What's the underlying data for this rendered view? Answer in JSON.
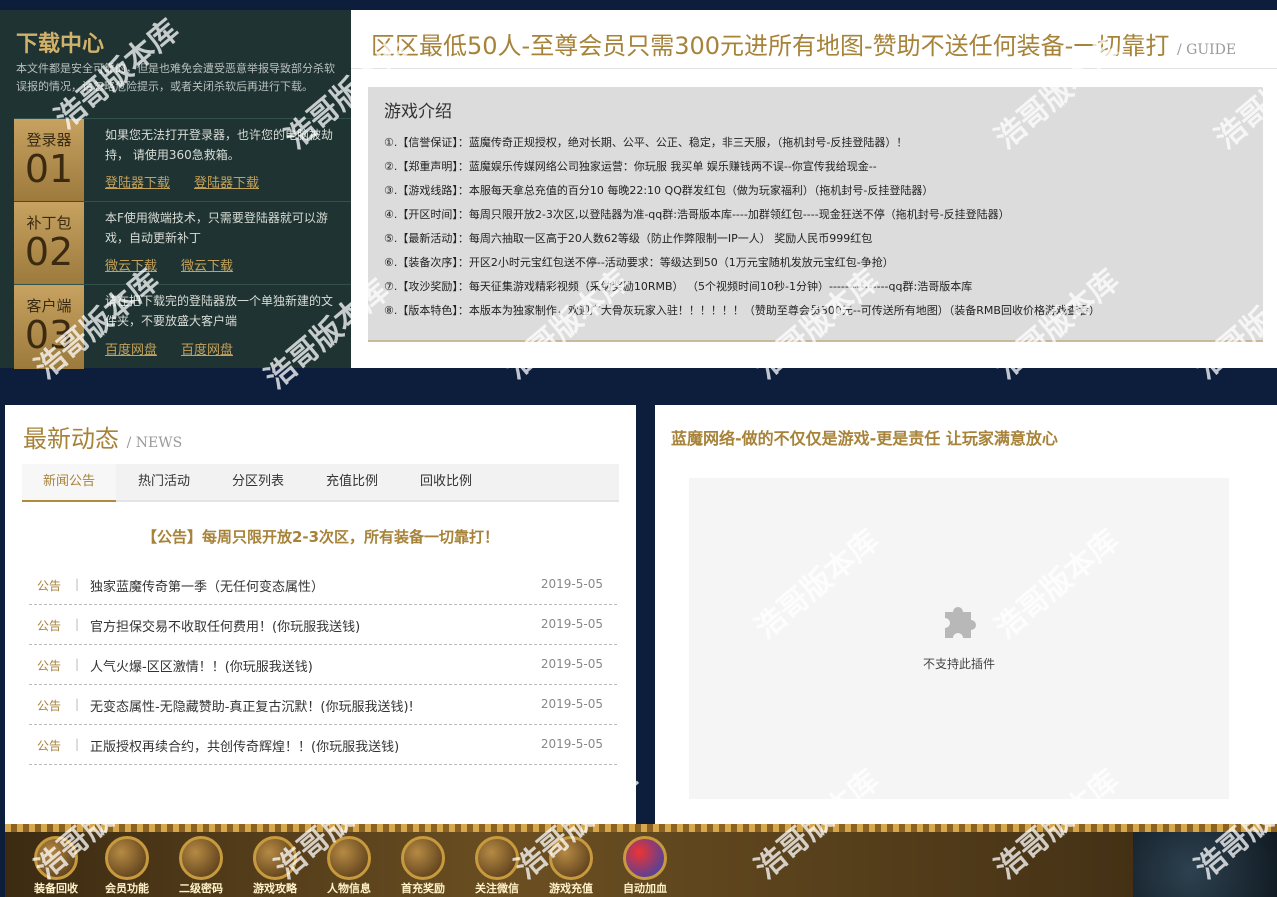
{
  "download": {
    "title": "下载中心",
    "desc": "本文件都是安全可靠的，但是也难免会遭受恶意举报导致部分杀软误报的情况，请忽略危险提示，或者关闭杀软后再进行下载。",
    "items": [
      {
        "name": "登录器",
        "num": "01",
        "text": "如果您无法打开登录器，也许您的电脑被劫持， 请使用360急救箱。",
        "links": [
          "登陆器下载",
          "登陆器下载"
        ]
      },
      {
        "name": "补丁包",
        "num": "02",
        "text": "本F使用微端技术，只需要登陆器就可以游戏，自动更新补丁",
        "links": [
          "微云下载",
          "微云下载"
        ]
      },
      {
        "name": "客户端",
        "num": "03",
        "text": "请在把下载完的登陆器放一个单独新建的文件夹，不要放盛大客户端",
        "links": [
          "百度网盘",
          "百度网盘"
        ]
      }
    ]
  },
  "guide": {
    "headline": "区区最低50人-至尊会员只需300元进所有地图-赞助不送任何装备-一切靠打",
    "en": "/ GUIDE",
    "box_title": "游戏介绍",
    "items": [
      "①.【信誉保证】：蓝魔传奇正规授权，绝对长期、公平、公正、稳定，非三天服，（拖机封号-反挂登陆器）！",
      "②.【郑重声明】：蓝魔娱乐传媒网络公司独家运营：你玩服 我买单 娱乐赚钱两不误--你宣传我给现金--",
      "③.【游戏线路】：本服每天拿总充值的百分10 每晚22:10 QQ群发红包（做为玩家福利）（拖机封号-反挂登陆器）",
      "④.【开区时间】：每周只限开放2-3次区,以登陆器为准-qq群:浩哥版本库----加群领红包----现金狂送不停（拖机封号-反挂登陆器）",
      "⑤.【最新活动】：每周六抽取一区高于20人数62等级（防止作弊限制一IP一人） 奖励人民币999红包",
      "⑥.【装备次序】：开区2小时元宝红包送不停--活动要求：等级达到50（1万元宝随机发放元宝红包-争抢）",
      "⑦.【攻沙奖励】：每天征集游戏精彩视频（采纳奖励10RMB） （5个视频时间10秒-1分钟）---------------qq群:浩哥版本库",
      "⑧.【版本特色】：本版本为独家制作，欢迎广大骨灰玩家入驻！！！！！！（赞助至尊会员300元--可传送所有地图）（装备RMB回收价格游戏查看）"
    ]
  },
  "news": {
    "title": "最新动态",
    "en": "/ NEWS",
    "tabs": [
      "新闻公告",
      "热门活动",
      "分区列表",
      "充值比例",
      "回收比例"
    ],
    "headline": "【公告】每周只限开放2-3次区，所有装备一切靠打！",
    "rows": [
      {
        "tag": "公告",
        "text": "独家蓝魔传奇第一季（无任何变态属性）",
        "date": "2019-5-05"
      },
      {
        "tag": "公告",
        "text": "官方担保交易不收取任何费用！(你玩服我送钱)",
        "date": "2019-5-05"
      },
      {
        "tag": "公告",
        "text": "人气火爆-区区激情！！(你玩服我送钱)",
        "date": "2019-5-05"
      },
      {
        "tag": "公告",
        "text": "无变态属性-无隐藏赞助-真正复古沉默！(你玩服我送钱)!",
        "date": "2019-5-05"
      },
      {
        "tag": "公告",
        "text": "正版授权再续合约，共创传奇辉煌！！(你玩服我送钱)",
        "date": "2019-5-05"
      }
    ]
  },
  "slogan": {
    "title": "蓝魔网络-做的不仅仅是游戏-更是责任 让玩家满意放心",
    "plugin_text": "不支持此插件"
  },
  "gamebar": {
    "buttons": [
      "装备回收",
      "会员功能",
      "二级密码",
      "游戏攻略",
      "人物信息",
      "首充奖励",
      "关注微信",
      "游戏充值",
      "自动加血"
    ]
  },
  "watermark": "浩哥版本库",
  "colors": {
    "gold": "#a7833a",
    "navy": "#0d1e3c",
    "panel_dark": "#1f3332"
  }
}
